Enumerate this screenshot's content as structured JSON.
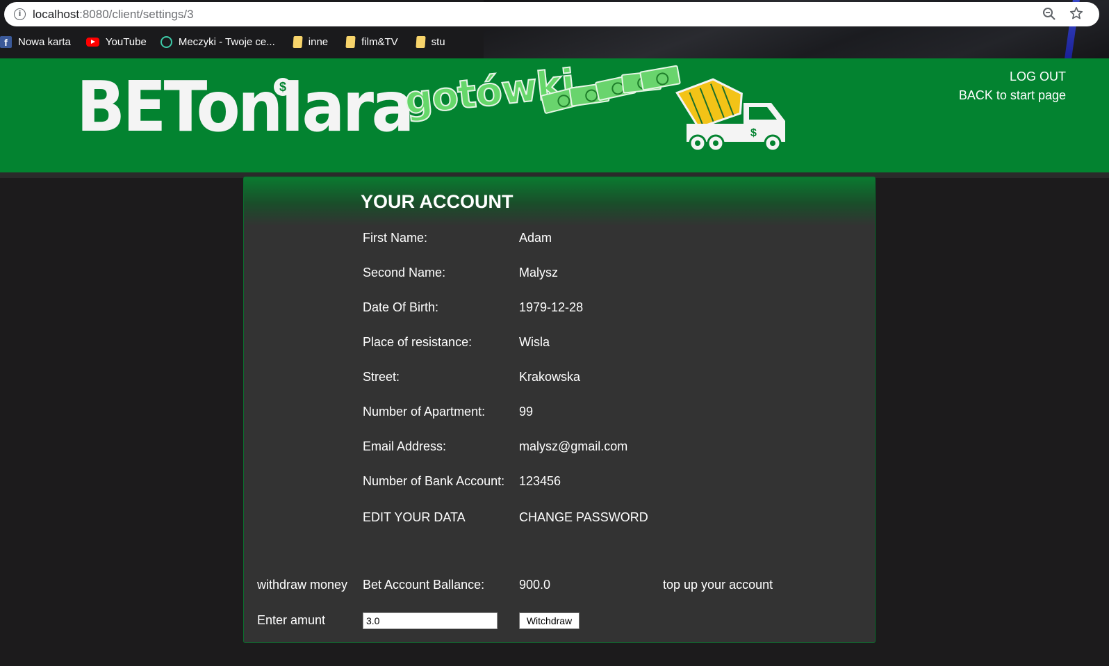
{
  "browser": {
    "url_host": "localhost",
    "url_path": ":8080/client/settings/3",
    "bookmarks": [
      {
        "label": "Nowa karta",
        "icon": "facebook-icon"
      },
      {
        "label": "YouTube",
        "icon": "youtube-icon"
      },
      {
        "label": "Meczyki - Twoje ce...",
        "icon": "meczyki-icon"
      },
      {
        "label": "inne",
        "icon": "folder-icon"
      },
      {
        "label": "film&TV",
        "icon": "folder-icon"
      },
      {
        "label": "stu",
        "icon": "folder-icon"
      }
    ]
  },
  "header": {
    "logo_main": "BETonIara",
    "logo_sub": "gotówki",
    "coin_symbol": "$",
    "logout": "LOG OUT",
    "back": "BACK to start page",
    "colors": {
      "band": "#038330",
      "logo": "#f4f4f4",
      "accent": "#66d76a",
      "drum": "#f3c317"
    }
  },
  "account": {
    "title": "YOUR ACCOUNT",
    "fields": [
      {
        "label": "First Name:",
        "value": "Adam"
      },
      {
        "label": "Second Name:",
        "value": "Malysz"
      },
      {
        "label": "Date Of Birth:",
        "value": "1979-12-28"
      },
      {
        "label": "Place of resistance:",
        "value": "Wisla"
      },
      {
        "label": "Street:",
        "value": "Krakowska"
      },
      {
        "label": "Number of Apartment:",
        "value": "99"
      },
      {
        "label": "Email Address:",
        "value": "malysz@gmail.com"
      },
      {
        "label": "Number of Bank Account:",
        "value": "123456"
      }
    ],
    "edit_link": "EDIT YOUR DATA",
    "change_password_link": "CHANGE PASSWORD",
    "withdraw_label": "withdraw money",
    "balance_label": "Bet Account Ballance:",
    "balance_value": "900.0",
    "top_up_link": "top up your account",
    "amount_label": "Enter amunt",
    "amount_value": "3.0",
    "withdraw_button": "Witchdraw"
  }
}
